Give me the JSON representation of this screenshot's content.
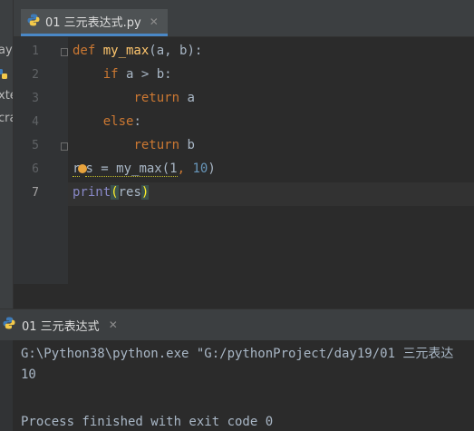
{
  "tab": {
    "filename": "01 三元表达式.py",
    "close": "✕"
  },
  "left_panel": {
    "fragments": [
      "ay",
      "xte",
      "cra"
    ]
  },
  "editor": {
    "line_numbers": [
      "1",
      "2",
      "3",
      "4",
      "5",
      "6",
      "7"
    ],
    "code": {
      "l1": {
        "kw": "def ",
        "fn": "my_max",
        "rest": "(a, b):"
      },
      "l2": {
        "indent": "    ",
        "kw": "if",
        "rest": " a > b:"
      },
      "l3": {
        "indent": "        ",
        "kw": "return",
        "rest": " a"
      },
      "l4": {
        "indent": "    ",
        "kw": "else",
        "rest": ":"
      },
      "l5": {
        "indent": "        ",
        "kw": "return",
        "rest": " b"
      },
      "l6": {
        "a": "r",
        "b": "s = my_max(1",
        "comma": ", ",
        "num2": "10",
        "close": ")"
      },
      "l7": {
        "fn": "print",
        "open": "(",
        "arg": "res",
        "close": ")"
      }
    }
  },
  "run": {
    "tab_label": "01 三元表达式",
    "close": "✕",
    "console": [
      "G:\\Python38\\python.exe \"G:/pythonProject/day19/01 三元表达",
      "10",
      "",
      "Process finished with exit code 0"
    ]
  },
  "colors": {
    "keyword": "#cc7832",
    "function": "#ffc66d",
    "number": "#6897bb",
    "builtin": "#8888c6",
    "accent": "#4a88c7"
  }
}
